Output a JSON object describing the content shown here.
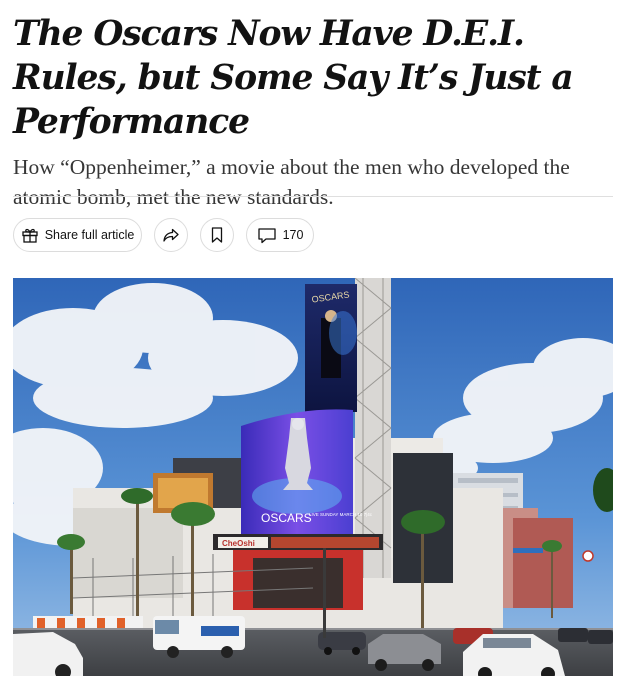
{
  "article": {
    "headline": "The Oscars Now Have D.E.I. Rules, but Some Say It’s Just a Performance",
    "summary": "How “Oppenheimer,” a movie about the men who developed the atomic bomb, met the new standards."
  },
  "toolbar": {
    "share_label": "Share full article",
    "comment_count": "170",
    "icons": {
      "share_full": "gift-icon",
      "share": "share-arrow-icon",
      "save": "bookmark-icon",
      "comments": "comment-bubble-icon"
    }
  },
  "photo": {
    "billboard_top_text": "OSCARS",
    "billboard_main_text": "OSCARS",
    "billboard_date_text": "LIVE SUNDAY MARCH 10 7|4c",
    "storefront_sign_text": "CheOshi",
    "colors": {
      "sky": "#3c78c8",
      "billboard": "#6a3fd8",
      "building": "#e9e7e3"
    }
  }
}
